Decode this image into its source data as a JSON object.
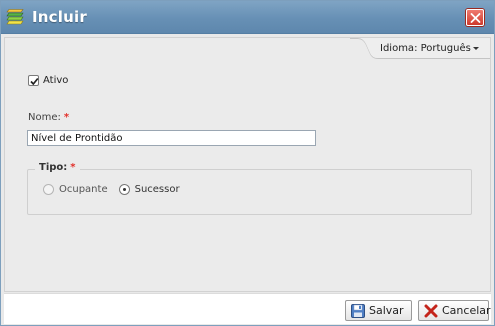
{
  "window": {
    "title": "Incluir",
    "icons": {
      "app": "stack-layers-icon",
      "close": "close-icon"
    },
    "colors": {
      "titlebar": "#6d95b9",
      "close": "#d84a3d"
    }
  },
  "language": {
    "label": "Idioma: Português",
    "icon": "chevron-down-icon"
  },
  "form": {
    "ativo": {
      "label": "Ativo",
      "checked": true
    },
    "nome": {
      "label": "Nome:",
      "required_mark": "*",
      "value": "Nível de Prontidão"
    },
    "tipo": {
      "legend": "Tipo:",
      "required_mark": "*",
      "options": [
        {
          "label": "Ocupante",
          "selected": false
        },
        {
          "label": "Sucessor",
          "selected": true
        }
      ]
    }
  },
  "footer": {
    "save_label": "Salvar",
    "cancel_label": "Cancelar",
    "icons": {
      "save": "floppy-disk-icon",
      "cancel": "red-x-icon"
    }
  }
}
